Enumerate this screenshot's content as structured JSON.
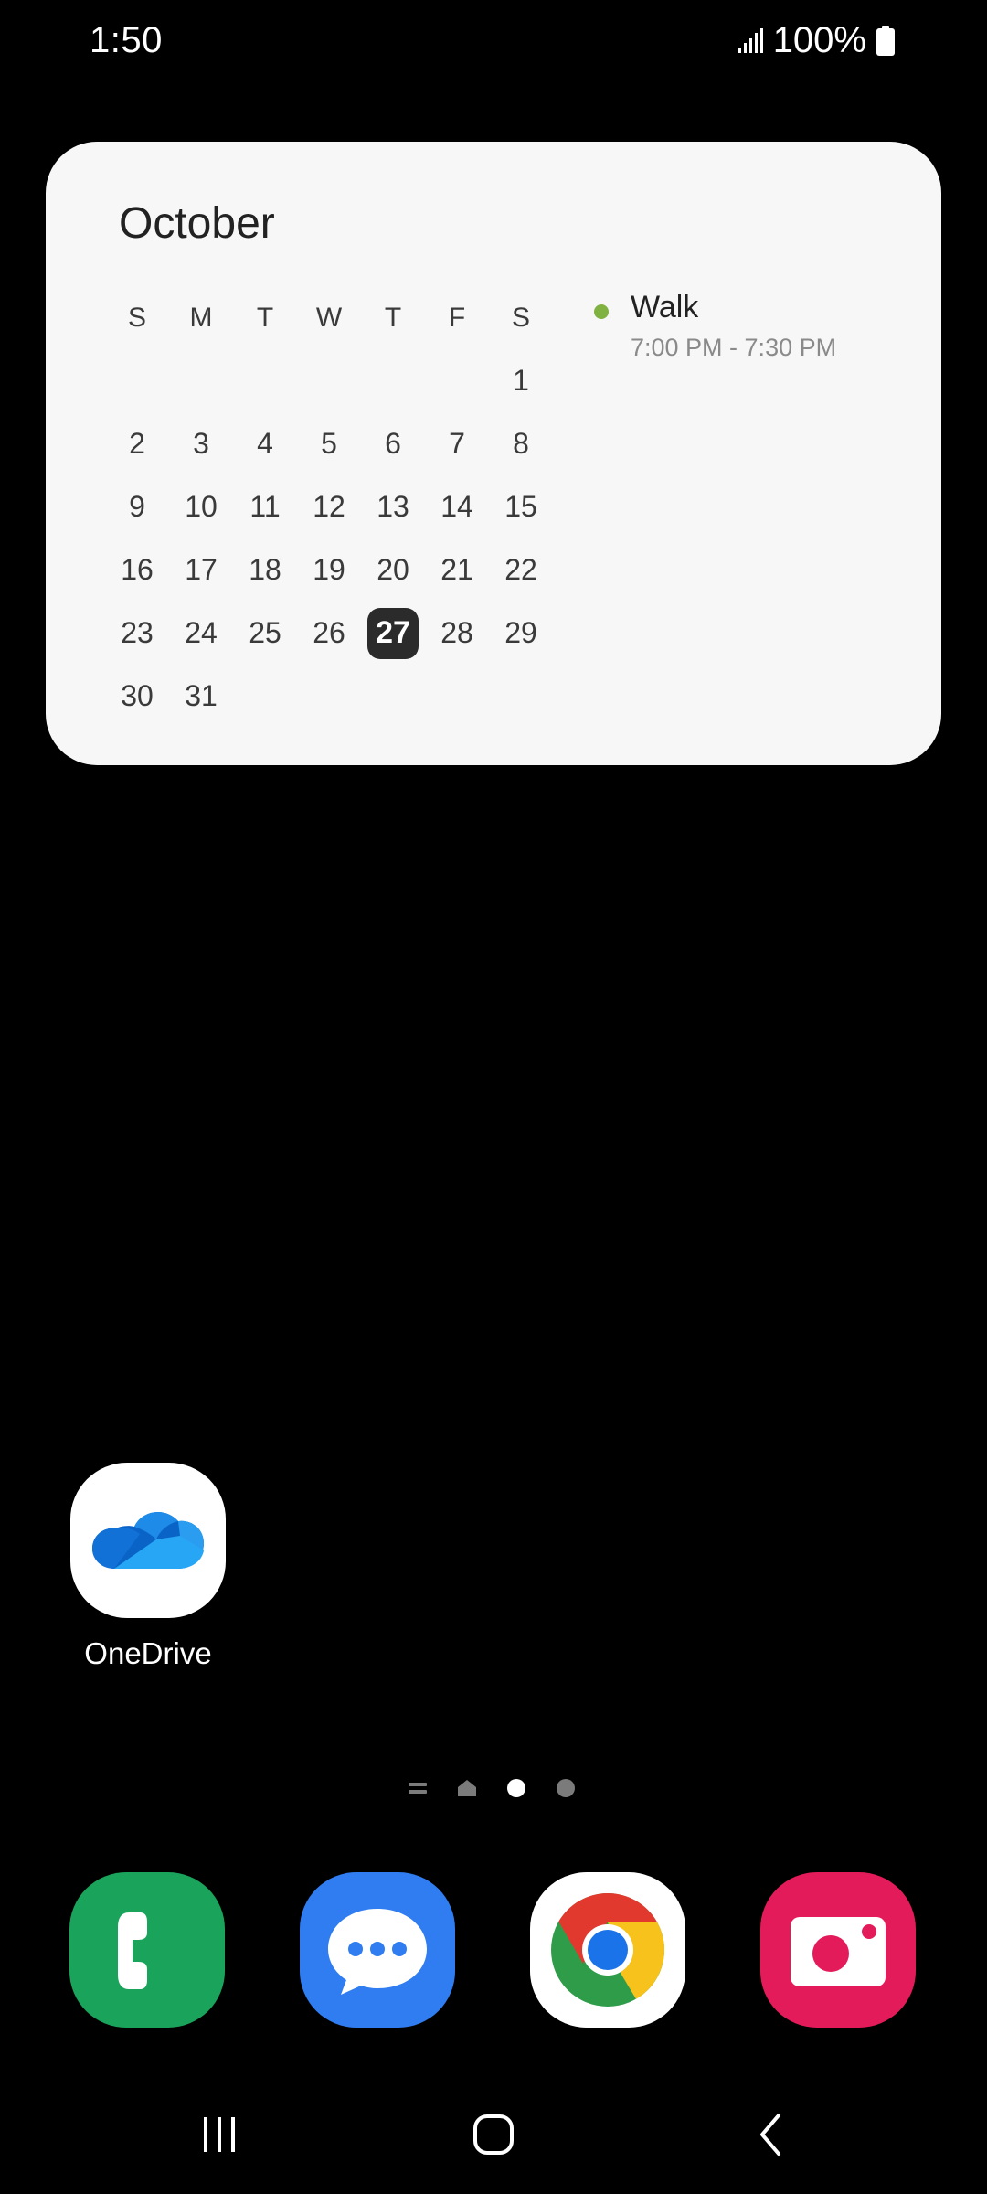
{
  "status_bar": {
    "time": "1:50",
    "battery_percent": "100%",
    "signal_icon": "signal-icon",
    "battery_icon": "battery-icon"
  },
  "calendar_widget": {
    "month": "October",
    "weekday_headers": [
      "S",
      "M",
      "T",
      "W",
      "T",
      "F",
      "S"
    ],
    "days": [
      "",
      "",
      "",
      "",
      "",
      "",
      "1",
      "2",
      "3",
      "4",
      "5",
      "6",
      "7",
      "8",
      "9",
      "10",
      "11",
      "12",
      "13",
      "14",
      "15",
      "16",
      "17",
      "18",
      "19",
      "20",
      "21",
      "22",
      "23",
      "24",
      "25",
      "26",
      "27",
      "28",
      "29",
      "30",
      "31",
      "",
      "",
      "",
      "",
      ""
    ],
    "today": "27",
    "event": {
      "title": "Walk",
      "time": "7:00 PM - 7:30 PM",
      "color": "#7fb241"
    }
  },
  "home_apps": [
    {
      "label": "OneDrive",
      "icon": "onedrive-icon"
    }
  ],
  "page_indicator": {
    "items": [
      "apps-list-icon",
      "home-icon",
      "page-dot",
      "page-dot"
    ],
    "active_index": 2
  },
  "dock": [
    {
      "icon": "phone-icon",
      "color": "#1aa35a"
    },
    {
      "icon": "messages-icon",
      "color": "#2f7df0"
    },
    {
      "icon": "chrome-icon",
      "color": "#ffffff"
    },
    {
      "icon": "camera-icon",
      "color": "#e31b5a"
    }
  ],
  "nav_bar": {
    "buttons": [
      "recents-icon",
      "home-button-icon",
      "back-icon"
    ]
  }
}
